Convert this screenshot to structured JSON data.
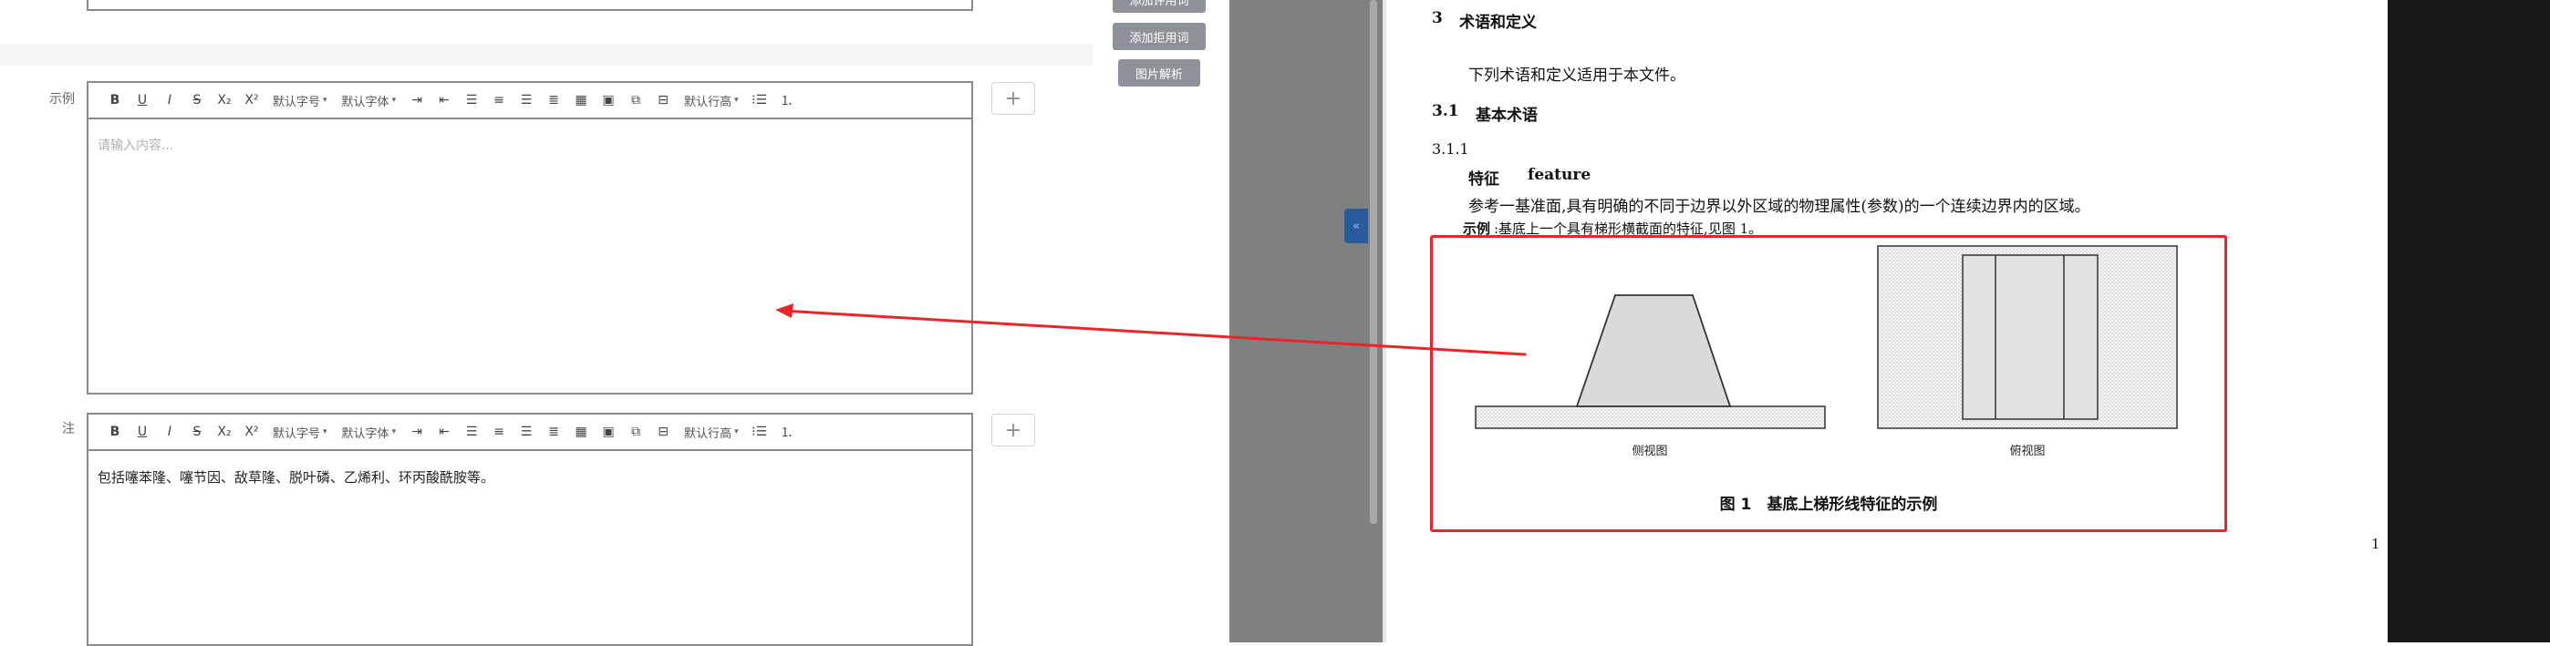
{
  "editor": {
    "toolbar": {
      "bold": "B",
      "underline": "U",
      "italic": "I",
      "strike": "S",
      "subscript": "X₂",
      "superscript": "X²",
      "font_size": "默认字号",
      "font_family": "默认字体",
      "line_height": "默认行高"
    },
    "example_label": "示例",
    "example_placeholder": "请输入内容...",
    "note_label": "注",
    "note_content": "包括噻苯隆、噻节因、敌草隆、脱叶磷、乙烯利、环丙酸酰胺等。",
    "add_button": "+"
  },
  "side_buttons": {
    "top_cut": "添加评用词",
    "add_reject": "添加拒用词",
    "image_parse": "图片解析"
  },
  "document": {
    "section_num": "3",
    "section_title": "术语和定义",
    "intro": "下列术语和定义适用于本文件。",
    "sub_num": "3.1",
    "sub_title": "基本术语",
    "term_num": "3.1.1",
    "term_zh": "特征",
    "term_en": "feature",
    "definition": "参考一基准面,具有明确的不同于边界以外区域的物理属性(参数)的一个连续边界内的区域。",
    "example_label": "示例",
    "example_text": ":基底上一个具有梯形横截面的特征,见图 1。",
    "side_view": "侧视图",
    "top_view": "俯视图",
    "figure_caption": "图 1　基底上梯形线特征的示例",
    "page_number": "1"
  },
  "colors": {
    "annotation_red": "#e8262a",
    "button_gray": "#8f9399",
    "scroll_gray": "#808080",
    "tab_blue": "#2a5a9e"
  }
}
